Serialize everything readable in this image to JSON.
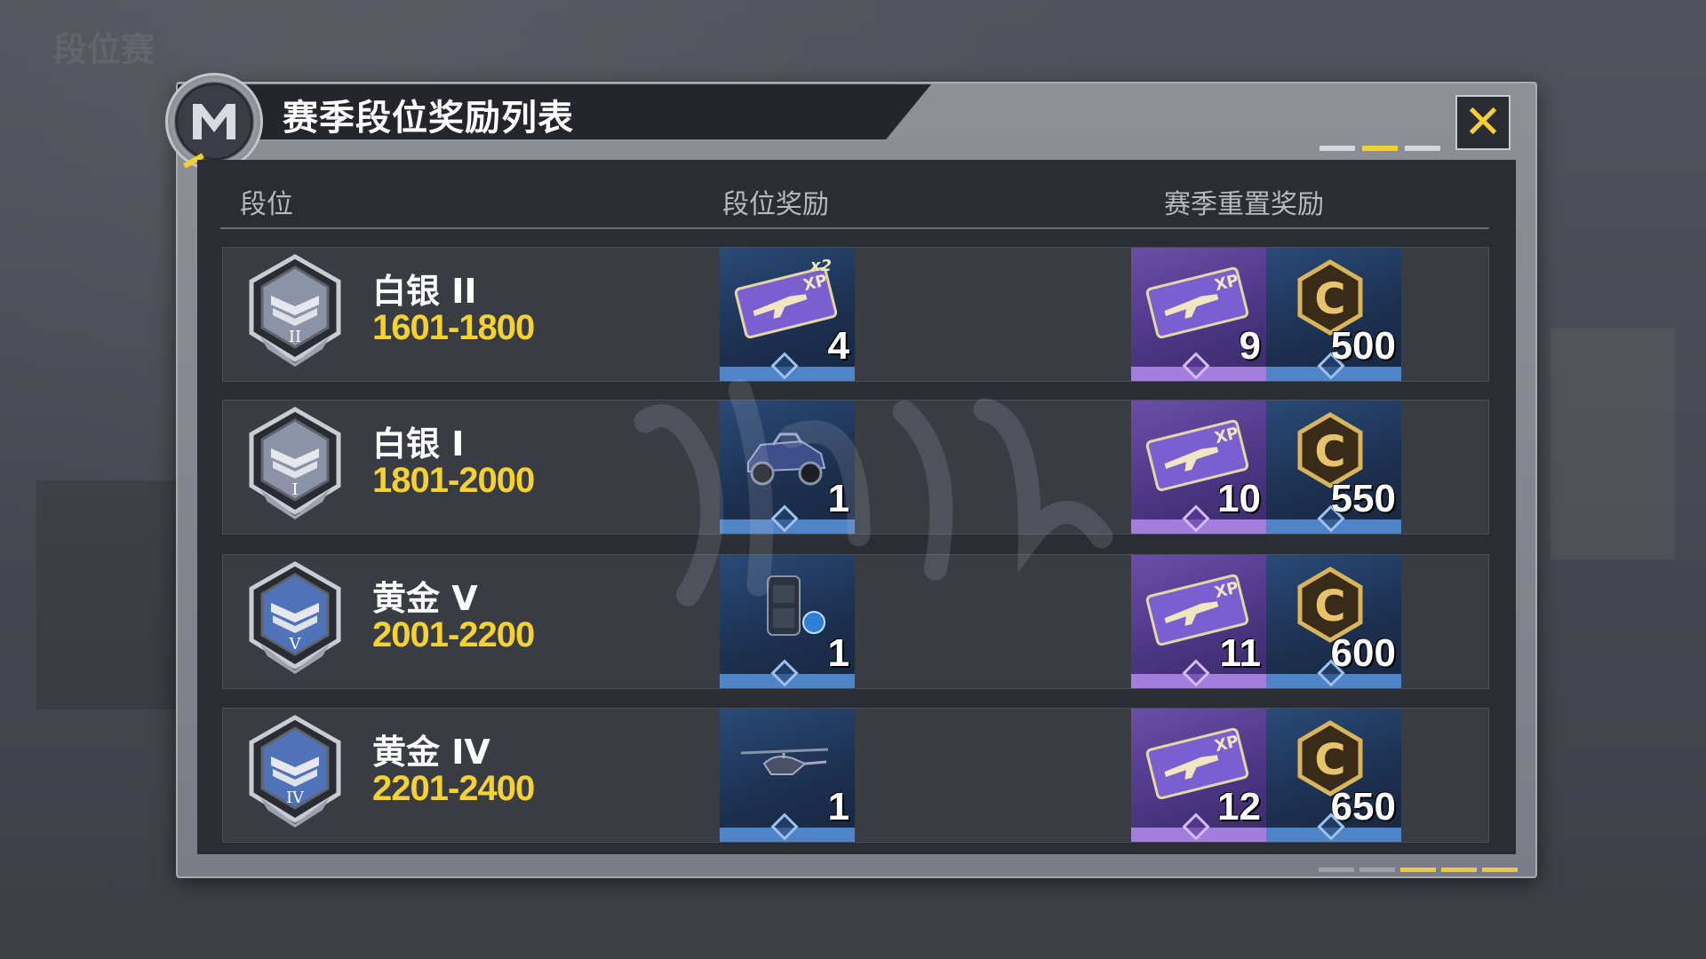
{
  "background": {
    "blur_text": "段位赛"
  },
  "dialog": {
    "title": "赛季段位奖励列表",
    "close_glyph": "✕"
  },
  "columns": {
    "rank": "段位",
    "rank_reward": "段位奖励",
    "season_reset_reward": "赛季重置奖励"
  },
  "rows": [
    {
      "name": "白银 II",
      "numeral": "II",
      "range": "1601-1800",
      "tier_color": "#8c93a6",
      "rank_reward": {
        "icon": "weapon-xp-card-icon",
        "multiplier": "x2",
        "qty": "4",
        "rarity": "blue"
      },
      "reset_rewards": [
        {
          "icon": "weapon-xp-card-icon",
          "qty": "9",
          "rarity": "purple"
        },
        {
          "icon": "cod-credit-icon",
          "qty": "500",
          "rarity": "blue"
        }
      ]
    },
    {
      "name": "白银 I",
      "numeral": "I",
      "range": "1801-2000",
      "tier_color": "#8c93a6",
      "rank_reward": {
        "icon": "vehicle-skin-icon",
        "qty": "1",
        "rarity": "blue"
      },
      "reset_rewards": [
        {
          "icon": "weapon-xp-card-icon",
          "qty": "10",
          "rarity": "purple"
        },
        {
          "icon": "cod-credit-icon",
          "qty": "550",
          "rarity": "blue"
        }
      ]
    },
    {
      "name": "黄金 V",
      "numeral": "V",
      "range": "2001-2200",
      "tier_color": "#4f72b8",
      "rank_reward": {
        "icon": "backpack-skin-icon",
        "qty": "1",
        "rarity": "blue"
      },
      "reset_rewards": [
        {
          "icon": "weapon-xp-card-icon",
          "qty": "11",
          "rarity": "purple"
        },
        {
          "icon": "cod-credit-icon",
          "qty": "600",
          "rarity": "blue"
        }
      ]
    },
    {
      "name": "黄金 IV",
      "numeral": "IV",
      "range": "2201-2400",
      "tier_color": "#4f72b8",
      "rank_reward": {
        "icon": "helicopter-skin-icon",
        "qty": "1",
        "rarity": "blue"
      },
      "reset_rewards": [
        {
          "icon": "weapon-xp-card-icon",
          "qty": "12",
          "rarity": "purple"
        },
        {
          "icon": "cod-credit-icon",
          "qty": "650",
          "rarity": "blue"
        }
      ]
    }
  ],
  "colors": {
    "accent_yellow": "#f6d22f",
    "rarity_blue": "#4f84c9",
    "rarity_purple": "#a57ddf"
  }
}
